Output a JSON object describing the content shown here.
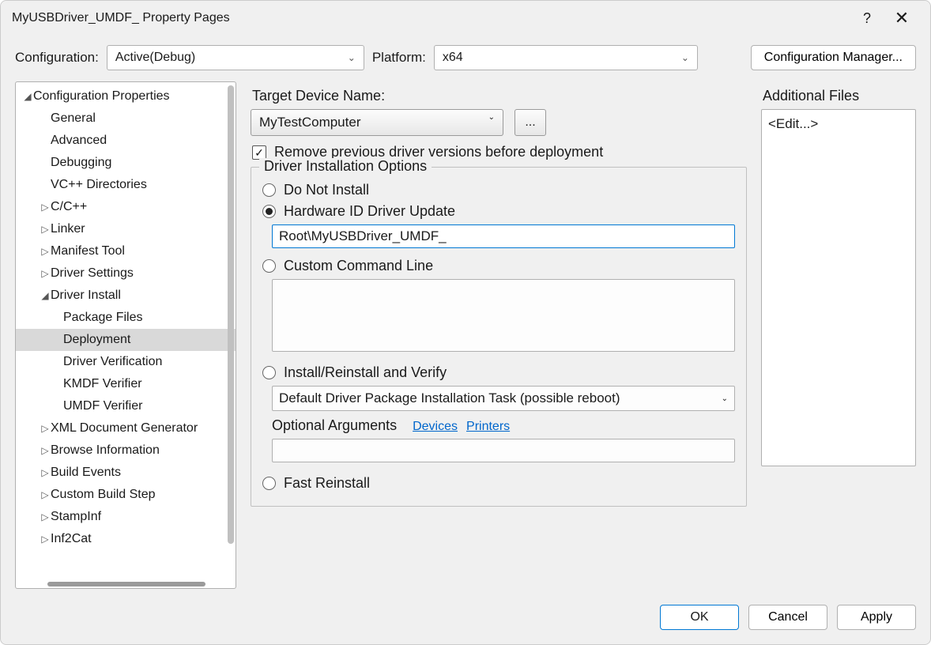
{
  "titlebar": {
    "title": "MyUSBDriver_UMDF_ Property Pages",
    "help": "?",
    "close": "✕"
  },
  "configRow": {
    "configurationLabel": "Configuration:",
    "configurationValue": "Active(Debug)",
    "platformLabel": "Platform:",
    "platformValue": "x64",
    "configManager": "Configuration Manager..."
  },
  "tree": {
    "root": "Configuration Properties",
    "items": [
      {
        "lvl": 1,
        "label": "General",
        "exp": null
      },
      {
        "lvl": 1,
        "label": "Advanced",
        "exp": null
      },
      {
        "lvl": 1,
        "label": "Debugging",
        "exp": null
      },
      {
        "lvl": 1,
        "label": "VC++ Directories",
        "exp": null
      },
      {
        "lvl": 1,
        "label": "C/C++",
        "exp": "▷"
      },
      {
        "lvl": 1,
        "label": "Linker",
        "exp": "▷"
      },
      {
        "lvl": 1,
        "label": "Manifest Tool",
        "exp": "▷"
      },
      {
        "lvl": 1,
        "label": "Driver Settings",
        "exp": "▷"
      },
      {
        "lvl": 1,
        "label": "Driver Install",
        "exp": "◢"
      },
      {
        "lvl": 2,
        "label": "Package Files",
        "exp": null
      },
      {
        "lvl": 2,
        "label": "Deployment",
        "exp": null,
        "selected": true
      },
      {
        "lvl": 2,
        "label": "Driver Verification",
        "exp": null
      },
      {
        "lvl": 2,
        "label": "KMDF Verifier",
        "exp": null
      },
      {
        "lvl": 2,
        "label": "UMDF Verifier",
        "exp": null
      },
      {
        "lvl": 1,
        "label": "XML Document Generator",
        "exp": "▷"
      },
      {
        "lvl": 1,
        "label": "Browse Information",
        "exp": "▷"
      },
      {
        "lvl": 1,
        "label": "Build Events",
        "exp": "▷"
      },
      {
        "lvl": 1,
        "label": "Custom Build Step",
        "exp": "▷"
      },
      {
        "lvl": 1,
        "label": "StampInf",
        "exp": "▷"
      },
      {
        "lvl": 1,
        "label": "Inf2Cat",
        "exp": "▷"
      }
    ]
  },
  "settings": {
    "targetDeviceLabel": "Target Device Name:",
    "targetDeviceValue": "MyTestComputer",
    "browseLabel": "...",
    "removePrevLabel": "Remove previous driver versions before deployment",
    "fieldsetLegend": "Driver Installation Options",
    "radioDoNotInstall": "Do Not Install",
    "radioHardwareId": "Hardware ID Driver Update",
    "hardwareIdValue": "Root\\MyUSBDriver_UMDF_",
    "radioCustomCmd": "Custom Command Line",
    "customCmdValue": "",
    "radioInstallVerify": "Install/Reinstall and Verify",
    "verifyComboValue": "Default Driver Package Installation Task (possible reboot)",
    "optArgsLabel": "Optional Arguments",
    "linkDevices": "Devices",
    "linkPrinters": "Printers",
    "optArgsValue": "",
    "radioFastReinstall": "Fast Reinstall"
  },
  "additionalFiles": {
    "label": "Additional Files",
    "value": "<Edit...>"
  },
  "footer": {
    "ok": "OK",
    "cancel": "Cancel",
    "apply": "Apply"
  }
}
